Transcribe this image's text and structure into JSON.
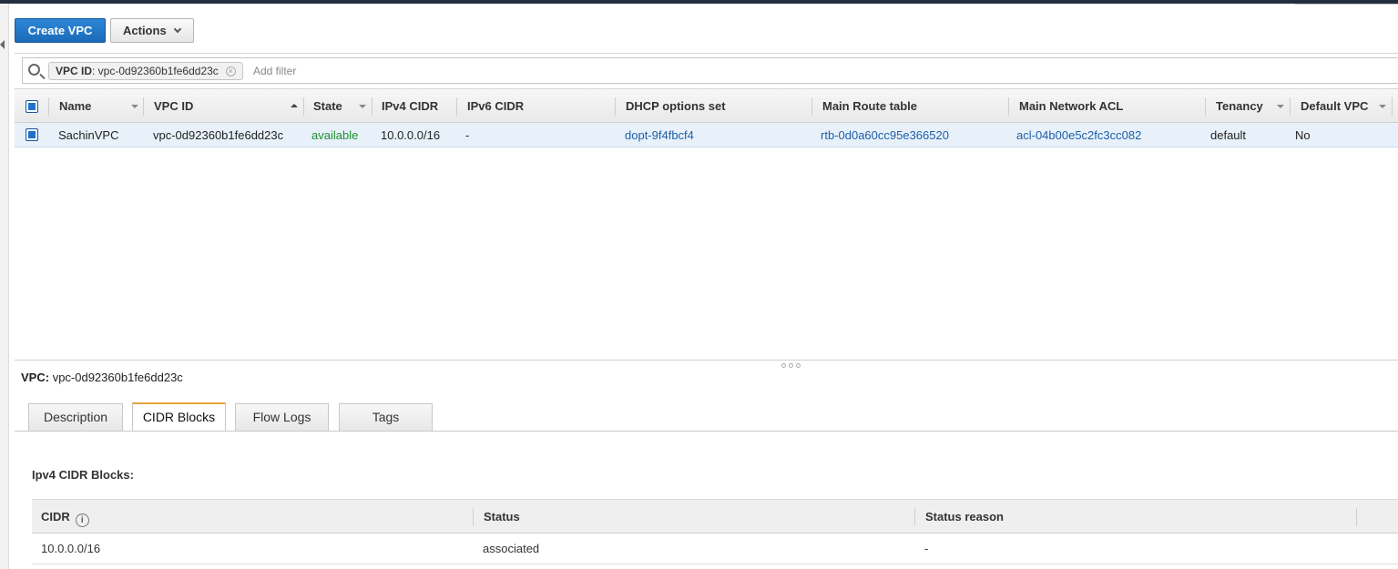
{
  "toolbar": {
    "create_label": "Create VPC",
    "actions_label": "Actions"
  },
  "filter": {
    "token_key": "VPC ID",
    "token_value": ": vpc-0d92360b1fe6dd23c",
    "placeholder": "Add filter"
  },
  "table": {
    "columns": [
      "Name",
      "VPC ID",
      "State",
      "IPv4 CIDR",
      "IPv6 CIDR",
      "DHCP options set",
      "Main Route table",
      "Main Network ACL",
      "Tenancy",
      "Default VPC"
    ],
    "rows": [
      {
        "name": "SachinVPC",
        "vpc_id": "vpc-0d92360b1fe6dd23c",
        "state": "available",
        "ipv4_cidr": "10.0.0.0/16",
        "ipv6_cidr": "-",
        "dhcp_options": "dopt-9f4fbcf4",
        "route_table": "rtb-0d0a60cc95e366520",
        "network_acl": "acl-04b00e5c2fc3cc082",
        "tenancy": "default",
        "default_vpc": "No"
      }
    ]
  },
  "detail": {
    "label": "VPC:",
    "vpc_id": "vpc-0d92360b1fe6dd23c",
    "tabs": [
      "Description",
      "CIDR Blocks",
      "Flow Logs",
      "Tags"
    ],
    "active_tab": "CIDR Blocks",
    "section_title": "Ipv4 CIDR Blocks:",
    "cidr_columns": [
      "CIDR",
      "Status",
      "Status reason"
    ],
    "cidr_rows": [
      {
        "cidr": "10.0.0.0/16",
        "status": "associated",
        "reason": "-"
      }
    ]
  },
  "colors": {
    "primary": "#1a6bb8",
    "status_green": "#1f8f2f",
    "link_blue": "#1d5fa8",
    "active_tab": "#e8a33c"
  }
}
